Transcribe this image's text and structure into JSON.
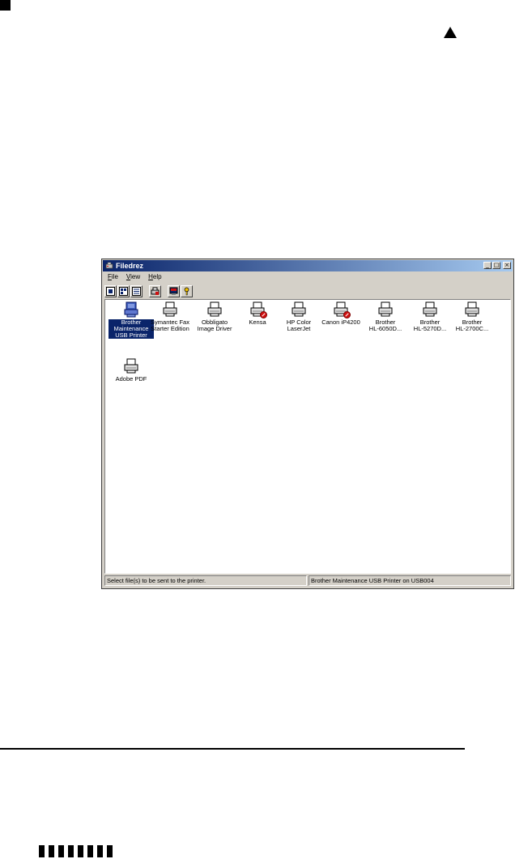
{
  "window": {
    "title": "Filedrez",
    "controls": [
      "_",
      "□",
      "×"
    ]
  },
  "menu": [
    {
      "label": "File",
      "accel": "F",
      "rest": "ile"
    },
    {
      "label": "View",
      "accel": "V",
      "rest": "iew"
    },
    {
      "label": "Help",
      "accel": "H",
      "rest": "elp"
    }
  ],
  "toolbar": {
    "buttons": [
      "view-large-icons",
      "view-small-icons",
      "view-list",
      "printer-properties",
      "select-printer",
      "help"
    ]
  },
  "printers": [
    {
      "label": "Brother\nMaintenance\nUSB Printer",
      "selected": true,
      "status": "default"
    },
    {
      "label": "Symantec Fax\nStarter Edition",
      "selected": false,
      "status": "normal"
    },
    {
      "label": "Obbligato\nImage Driver",
      "selected": false,
      "status": "normal"
    },
    {
      "label": "Kensa",
      "selected": false,
      "status": "error"
    },
    {
      "label": "HP Color\nLaserJet",
      "selected": false,
      "status": "normal"
    },
    {
      "label": "Canon iP4200",
      "selected": false,
      "status": "error"
    },
    {
      "label": "Brother\nHL-6050D...",
      "selected": false,
      "status": "normal"
    },
    {
      "label": "Brother\nHL-5270D...",
      "selected": false,
      "status": "normal"
    },
    {
      "label": "Brother\nHL-2700C...",
      "selected": false,
      "status": "normal"
    },
    {
      "label": "Adobe PDF",
      "selected": false,
      "status": "normal"
    }
  ],
  "statusbar": {
    "left": "Select file(s) to be sent to the printer.",
    "right": "Brother Maintenance USB Printer on USB004"
  },
  "colors": {
    "titlebar": "#0a246a",
    "selection": "#0a246a",
    "error_badge": "#d01010"
  }
}
